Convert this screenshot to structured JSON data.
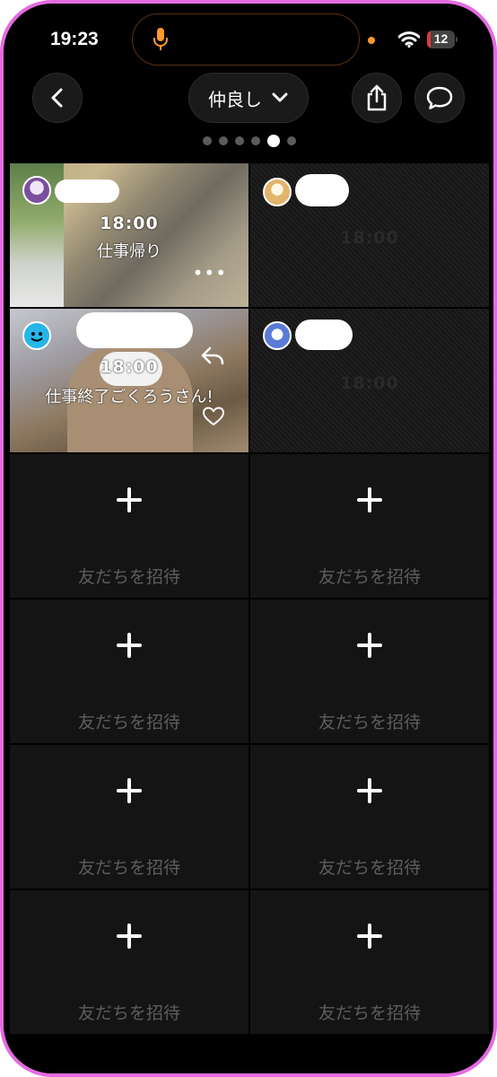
{
  "status_bar": {
    "time": "19:23",
    "battery_level": "12",
    "battery_fraction": 0.12,
    "icons": [
      "microphone-icon",
      "wifi-icon",
      "battery-icon"
    ]
  },
  "header": {
    "group_name": "仲良し",
    "group_chevron_icon": "chevron-down-icon",
    "back_icon": "chevron-left-icon",
    "share_icon": "share-icon",
    "chat_icon": "chat-bubble-icon"
  },
  "pager": {
    "count": 6,
    "active_index": 4
  },
  "posts": [
    {
      "time": "18:00",
      "caption": "仕事帰り",
      "has_photo": true,
      "more_label": "•••"
    },
    {
      "time": "18:00",
      "caption": "",
      "has_photo": false
    },
    {
      "time": "18:00",
      "caption": "仕事終了ごくろうさん!",
      "has_photo": true
    },
    {
      "time": "18:00",
      "caption": "",
      "has_photo": false
    }
  ],
  "invite_slots": [
    {
      "label": "友だちを招待"
    },
    {
      "label": "友だちを招待"
    },
    {
      "label": "友だちを招待"
    },
    {
      "label": "友だちを招待"
    },
    {
      "label": "友だちを招待"
    },
    {
      "label": "友だちを招待"
    },
    {
      "label": "友だちを招待"
    },
    {
      "label": "友だちを招待"
    }
  ],
  "colors": {
    "frame": "#e46be0",
    "background": "#000000",
    "cell": "#141414",
    "invite_text": "#5d5d5d",
    "battery_low": "#e03a3a",
    "mic_accent": "#ff9a2a"
  }
}
